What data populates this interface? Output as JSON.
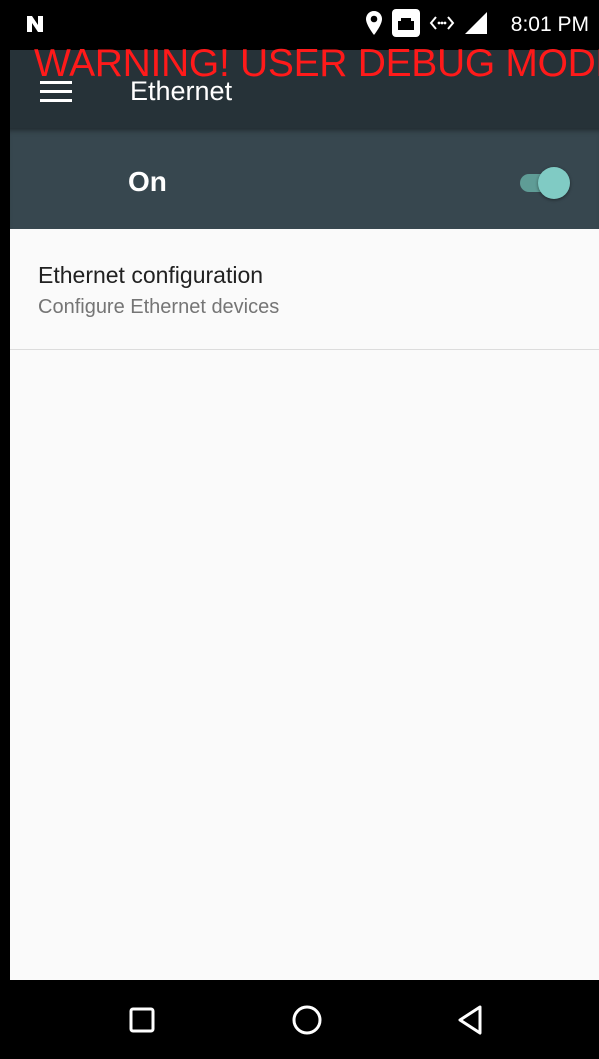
{
  "status_bar": {
    "left_icon": "n-notification-icon",
    "icons": [
      "location-icon",
      "ethernet-icon",
      "data-transfer-icon",
      "signal-icon"
    ],
    "time": "8:01 PM"
  },
  "debug_banner": "WARNING! USER DEBUG MODE",
  "toolbar": {
    "menu_icon": "hamburger-menu-icon",
    "title": "Ethernet"
  },
  "master_switch": {
    "label": "On",
    "checked": true,
    "accent_color": "#80cbc4"
  },
  "preferences": [
    {
      "title": "Ethernet configuration",
      "summary": "Configure Ethernet devices"
    }
  ],
  "nav_bar": {
    "buttons": [
      "recents-icon",
      "home-icon",
      "back-icon"
    ]
  },
  "colors": {
    "toolbar": "#263238",
    "switch_bar": "#37474f",
    "banner": "#ff1a1a",
    "background": "#fafafa"
  }
}
